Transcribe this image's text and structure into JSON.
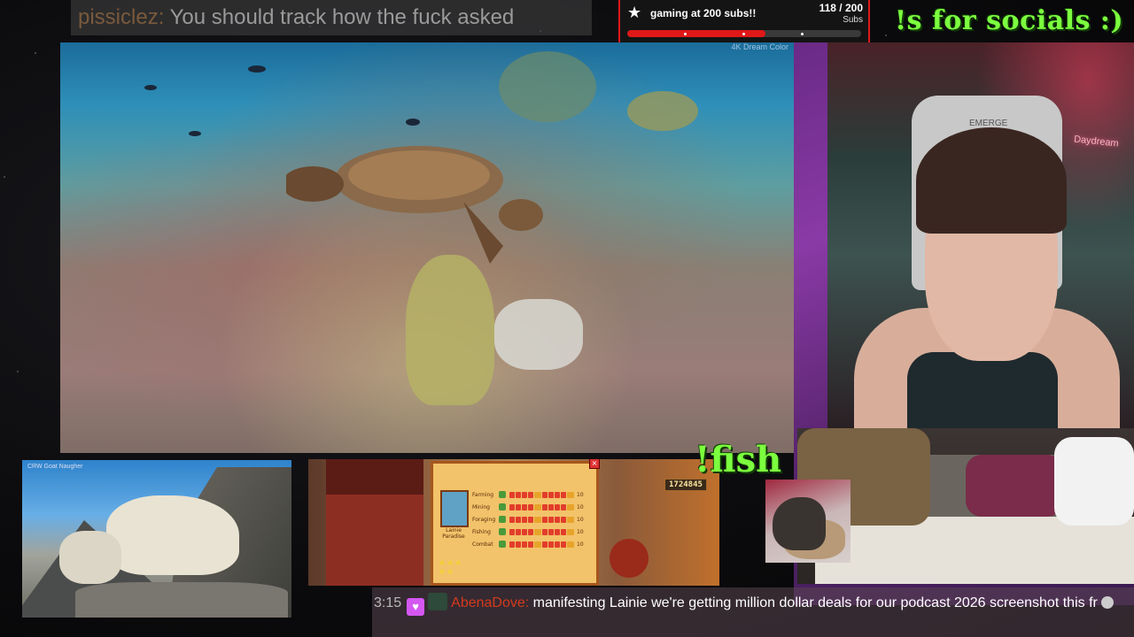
{
  "top_chat": {
    "username": "pissiclez:",
    "message": "You should track how the fuck asked"
  },
  "sub_goal": {
    "icon": "star-icon",
    "title": "gaming at 200 subs!!",
    "count": "118 / 200",
    "unit": "Subs",
    "progress": 0.59,
    "color": "#e01818"
  },
  "socials_text": "!s for socials :)",
  "fish_text": "!fish",
  "main_video": {
    "credit": "4K Dream Color"
  },
  "goat_cam": {
    "credit": "CRW Goat Naugher"
  },
  "webcam": {
    "chair_brand": "EMERGE",
    "neon_sign": "Daydream"
  },
  "game": {
    "player_name": "Lainie Paradise",
    "gold": "1724845",
    "skills": [
      {
        "label": "Farming",
        "level": "10"
      },
      {
        "label": "Mining",
        "level": "10"
      },
      {
        "label": "Foraging",
        "level": "10"
      },
      {
        "label": "Fishing",
        "level": "10"
      },
      {
        "label": "Combat",
        "level": "10"
      }
    ]
  },
  "bottom_chat": {
    "time": "3:15",
    "username": "AbenaDove:",
    "message": "manifesting Lainie we're getting million dollar deals for our podcast 2026 screenshot this fr"
  }
}
